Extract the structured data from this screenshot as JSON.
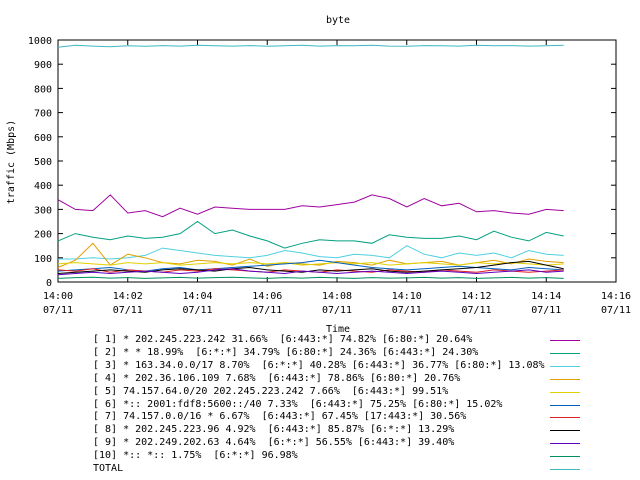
{
  "chart_data": {
    "type": "line",
    "title": "byte",
    "xlabel": "Time",
    "ylabel": "traffic (Mbps)",
    "ylim": [
      0,
      1000
    ],
    "yticks": [
      0,
      100,
      200,
      300,
      400,
      500,
      600,
      700,
      800,
      900,
      1000
    ],
    "xlim": [
      0,
      16
    ],
    "xticks": [
      {
        "value": 0,
        "time": "14:00",
        "date": "07/11"
      },
      {
        "value": 2,
        "time": "14:02",
        "date": "07/11"
      },
      {
        "value": 4,
        "time": "14:04",
        "date": "07/11"
      },
      {
        "value": 6,
        "time": "14:06",
        "date": "07/11"
      },
      {
        "value": 8,
        "time": "14:08",
        "date": "07/11"
      },
      {
        "value": 10,
        "time": "14:10",
        "date": "07/11"
      },
      {
        "value": 12,
        "time": "14:12",
        "date": "07/11"
      },
      {
        "value": 14,
        "time": "14:14",
        "date": "07/11"
      },
      {
        "value": 16,
        "time": "14:16",
        "date": "07/11"
      }
    ],
    "x": [
      0,
      0.5,
      1,
      1.5,
      2,
      2.5,
      3,
      3.5,
      4,
      4.5,
      5,
      5.5,
      6,
      6.5,
      7,
      7.5,
      8,
      8.5,
      9,
      9.5,
      10,
      10.5,
      11,
      11.5,
      12,
      12.5,
      13,
      13.5,
      14,
      14.5
    ],
    "series": [
      {
        "name": "[ 1] * 202.245.223.242 31.66%  [6:443:*] 74.82% [6:80:*] 20.64%",
        "color": "#a000a0",
        "values": [
          340,
          300,
          295,
          360,
          285,
          295,
          270,
          305,
          280,
          310,
          305,
          300,
          300,
          300,
          315,
          310,
          320,
          330,
          360,
          345,
          310,
          345,
          315,
          325,
          290,
          295,
          285,
          280,
          300,
          295
        ]
      },
      {
        "name": "[ 2] * * 18.99%  [6:*:*] 34.79% [6:80:*] 24.36% [6:443:*] 24.30%",
        "color": "#00a080",
        "values": [
          170,
          200,
          185,
          175,
          190,
          180,
          185,
          200,
          250,
          200,
          215,
          190,
          170,
          140,
          160,
          175,
          170,
          170,
          160,
          195,
          185,
          180,
          180,
          190,
          175,
          210,
          185,
          170,
          205,
          190
        ]
      },
      {
        "name": "[ 3] * 163.34.0.0/17 8.70%  [6:*:*] 40.28% [6:443:*] 36.77% [6:80:*] 13.08%",
        "color": "#50d0e0",
        "values": [
          95,
          95,
          100,
          95,
          100,
          110,
          140,
          130,
          120,
          110,
          105,
          100,
          110,
          130,
          120,
          105,
          100,
          115,
          110,
          100,
          150,
          115,
          100,
          120,
          110,
          120,
          100,
          130,
          115,
          110
        ]
      },
      {
        "name": "[ 4] * 202.36.106.109 7.68%  [6:443:*] 78.86% [6:80:*] 20.76%",
        "color": "#e0a000",
        "values": [
          60,
          90,
          160,
          70,
          115,
          100,
          80,
          75,
          90,
          85,
          70,
          95,
          65,
          80,
          75,
          70,
          85,
          80,
          70,
          90,
          75,
          80,
          85,
          70,
          80,
          90,
          75,
          95,
          85,
          80
        ]
      },
      {
        "name": "[ 5] 74.157.64.0/20 202.245.223.242 7.66%  [6:443:*] 99.51%",
        "color": "#e0d000",
        "values": [
          75,
          80,
          75,
          70,
          80,
          75,
          80,
          70,
          75,
          80,
          75,
          80,
          75,
          80,
          70,
          75,
          80,
          75,
          80,
          70,
          75,
          80,
          75,
          70,
          80,
          75,
          80,
          75,
          70,
          75
        ]
      },
      {
        "name": "[ 6] *:: 2001:fdf8:5600::/40 7.33%  [6:443:*] 75.25% [6:80:*] 15.02%",
        "color": "#0060c0",
        "values": [
          45,
          50,
          55,
          60,
          50,
          45,
          55,
          60,
          50,
          55,
          60,
          65,
          70,
          75,
          80,
          90,
          80,
          70,
          60,
          55,
          50,
          55,
          60,
          65,
          60,
          55,
          50,
          60,
          55,
          50
        ]
      },
      {
        "name": "[ 7] 74.157.0.0/16 * 6.67%  [6:443:*] 67.45% [17:443:*] 30.56%",
        "color": "#e02020",
        "values": [
          50,
          45,
          55,
          40,
          50,
          45,
          40,
          50,
          45,
          55,
          50,
          45,
          40,
          50,
          45,
          40,
          50,
          45,
          40,
          50,
          45,
          40,
          50,
          45,
          40,
          50,
          45,
          40,
          45,
          50
        ]
      },
      {
        "name": "[ 8] * 202.245.223.96 4.92%  [6:443:*] 85.87% [6:*:*] 13.29%",
        "color": "#000000",
        "values": [
          35,
          40,
          45,
          50,
          45,
          40,
          50,
          55,
          50,
          45,
          55,
          60,
          50,
          45,
          40,
          50,
          45,
          50,
          55,
          45,
          40,
          45,
          50,
          55,
          60,
          70,
          80,
          85,
          70,
          55
        ]
      },
      {
        "name": "[ 9] * 202.249.202.63 4.64%  [6:*:*] 56.55% [6:443:*] 39.40%",
        "color": "#6000c0",
        "values": [
          30,
          35,
          40,
          35,
          40,
          45,
          40,
          35,
          40,
          50,
          55,
          45,
          40,
          35,
          45,
          40,
          35,
          40,
          45,
          40,
          35,
          40,
          45,
          40,
          35,
          40,
          45,
          50,
          40,
          45
        ]
      },
      {
        "name": "[10] *:: *:: 1.75%  [6:*:*] 96.98%",
        "color": "#009060",
        "values": [
          15,
          18,
          20,
          16,
          18,
          15,
          17,
          19,
          16,
          18,
          20,
          17,
          15,
          18,
          16,
          19,
          17,
          15,
          18,
          16,
          17,
          19,
          16,
          18,
          15,
          17,
          19,
          16,
          18,
          15
        ]
      },
      {
        "name": "TOTAL",
        "color": "#40b8c0",
        "values": [
          970,
          978,
          975,
          972,
          976,
          974,
          977,
          975,
          978,
          976,
          975,
          977,
          974,
          976,
          978,
          975,
          977,
          976,
          978,
          975,
          974,
          977,
          976,
          975,
          978,
          976,
          977,
          975,
          976,
          978
        ]
      }
    ],
    "grid": false,
    "legend_position": "bottom"
  }
}
